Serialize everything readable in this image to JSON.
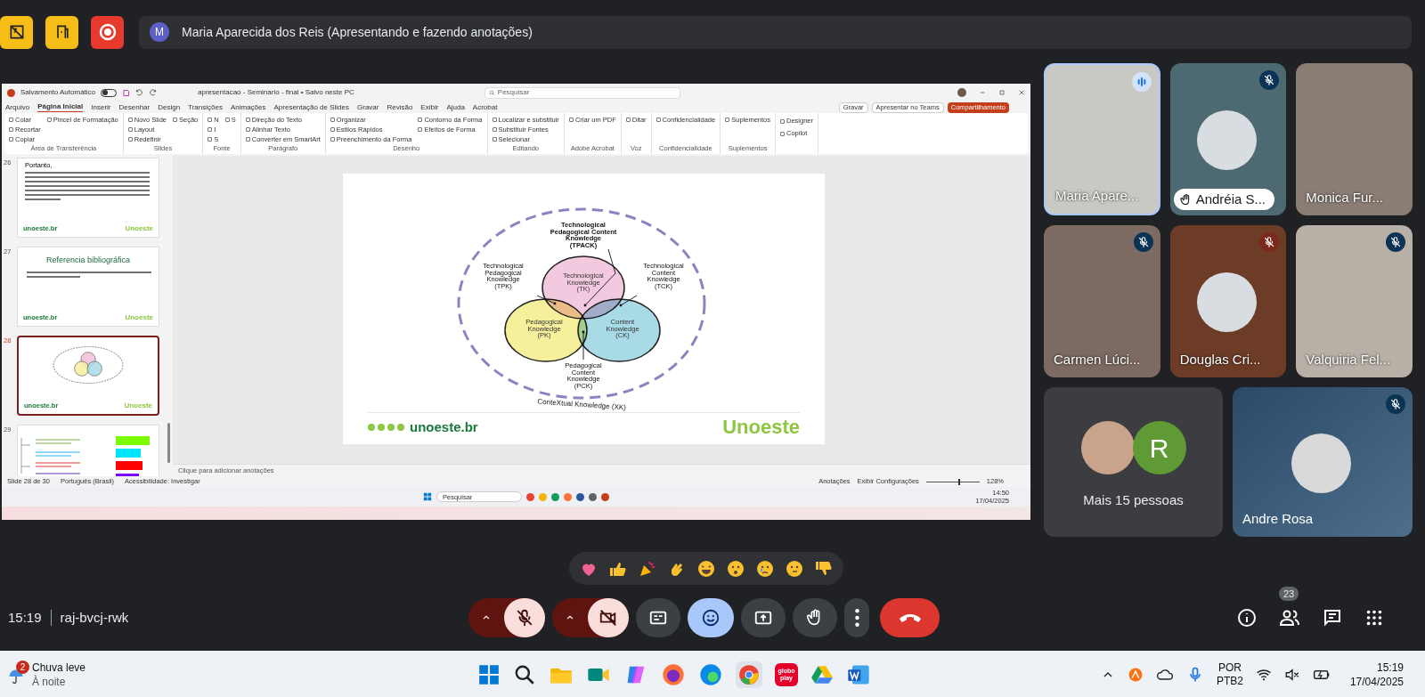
{
  "top_bar": {
    "presenter_initial": "M",
    "presenter_label": "Maria Aparecida dos Reis (Apresentando e fazendo anotações)"
  },
  "shared_screen": {
    "autosave_label": "Salvamento Automático",
    "autosave_on": false,
    "document_title": "apresentacao - Seminario - final • Salvo neste PC",
    "search_placeholder": "Pesquisar",
    "ribbon_tabs": [
      {
        "label": "Arquivo",
        "selected": false
      },
      {
        "label": "Página Inicial",
        "selected": true
      },
      {
        "label": "Inserir",
        "selected": false
      },
      {
        "label": "Desenhar",
        "selected": false
      },
      {
        "label": "Design",
        "selected": false
      },
      {
        "label": "Transições",
        "selected": false
      },
      {
        "label": "Animações",
        "selected": false
      },
      {
        "label": "Apresentação de Slides",
        "selected": false
      },
      {
        "label": "Gravar",
        "selected": false
      },
      {
        "label": "Revisão",
        "selected": false
      },
      {
        "label": "Exibir",
        "selected": false
      },
      {
        "label": "Ajuda",
        "selected": false
      },
      {
        "label": "Acrobat",
        "selected": false
      }
    ],
    "ribbon_buttons": [
      {
        "label": "Gravar",
        "kind": "plain"
      },
      {
        "label": "Apresentar no Teams",
        "kind": "plain"
      },
      {
        "label": "Compartilhamento",
        "kind": "accent"
      }
    ],
    "ribbon_groups": [
      {
        "label": "Área de Transferência",
        "items": [
          "Colar",
          "Recortar",
          "Copiar",
          "Pincel de Formatação"
        ]
      },
      {
        "label": "Slides",
        "items": [
          "Novo Slide",
          "Layout",
          "Redefinir",
          "Seção"
        ]
      },
      {
        "label": "Fonte",
        "items": [
          "N",
          "I",
          "S",
          "S"
        ]
      },
      {
        "label": "Parágrafo",
        "items": [
          "Direção do Texto",
          "Alinhar Texto",
          "Converter em SmartArt"
        ]
      },
      {
        "label": "Desenho",
        "items": [
          "Organizar",
          "Estilos Rápidos",
          "Preenchimento da Forma",
          "Contorno da Forma",
          "Efeitos de Forma"
        ]
      },
      {
        "label": "Editando",
        "items": [
          "Localizar e substituir",
          "Substituir Fontes",
          "Selecionar"
        ]
      },
      {
        "label": "Adobe Acrobat",
        "items": [
          "Criar um PDF"
        ]
      },
      {
        "label": "Voz",
        "items": [
          "Ditar"
        ]
      },
      {
        "label": "Confidencialidade",
        "items": [
          "Confidencialidade"
        ]
      },
      {
        "label": "Suplementos",
        "items": [
          "Suplementos"
        ]
      },
      {
        "items": [
          "Designer",
          "Copilot"
        ]
      }
    ],
    "slides": [
      {
        "number": "26",
        "kind": "text",
        "selected": false,
        "heading": "Portanto,",
        "footer_url": "unoeste.br",
        "brand": "Unoeste"
      },
      {
        "number": "27",
        "kind": "title",
        "selected": false,
        "title": "Referencia bibliográfica",
        "footer_url": "unoeste.br",
        "brand": "Unoeste"
      },
      {
        "number": "28",
        "kind": "diagram",
        "selected": true,
        "footer_url": "unoeste.br",
        "brand": "Unoeste"
      },
      {
        "number": "29",
        "kind": "chart",
        "selected": false
      }
    ],
    "diagram": {
      "circles": [
        {
          "label": [
            "Technological",
            "Knowledge",
            "(TK)"
          ],
          "color": "#f2c9de"
        },
        {
          "label": [
            "Pedagogical",
            "Knowledge",
            "(PK)"
          ],
          "color": "#f6ef9c"
        },
        {
          "label": [
            "Content",
            "Knowledge",
            "(CK)"
          ],
          "color": "#a9dbe6"
        }
      ],
      "callouts": [
        {
          "label": [
            "Technological",
            "Pedagogical Content",
            "Knowledge",
            "(TPACK)"
          ]
        },
        {
          "label": [
            "Technological",
            "Pedagogical",
            "Knowledge",
            "(TPK)"
          ]
        },
        {
          "label": [
            "Technological",
            "Content",
            "Knowledge",
            "(TCK)"
          ]
        },
        {
          "label": [
            "Pedagogical",
            "Content",
            "Knowledge",
            "(PCK)"
          ]
        }
      ],
      "context_label": "ConteXtual Knowledge (XK)"
    },
    "slide_footer_url": "unoeste.br",
    "slide_brand": "Unoeste",
    "notes_placeholder": "Clique para adicionar anotações",
    "status_bar": {
      "slide_counter": "Slide 28 de 30",
      "language": "Português (Brasil)",
      "accessibility": "Acessibilidade: Investigar",
      "notes": "Anotações",
      "display_settings": "Exibir Configurações",
      "zoom_slider": {
        "level": 0.62
      },
      "zoom": "128%"
    },
    "taskbar": {
      "search_placeholder": "Pesquisar",
      "time": "14:50",
      "date": "17/04/2025"
    }
  },
  "participants": [
    {
      "name": "Maria Apare...",
      "kind": "video",
      "muted": false,
      "speaking": true,
      "hand_raised": false,
      "color": "#c9c9c4"
    },
    {
      "name": "Andréia S...",
      "kind": "avatar",
      "muted": true,
      "speaking": false,
      "hand_raised": true,
      "color": "#4d6a73"
    },
    {
      "name": "Monica Fur...",
      "kind": "video",
      "muted": false,
      "speaking": false,
      "hand_raised": false,
      "color": "#8a7d74"
    },
    {
      "name": "Carmen Lúci...",
      "kind": "video",
      "muted": true,
      "speaking": false,
      "hand_raised": false,
      "color": "#7d6a62"
    },
    {
      "name": "Douglas Cri...",
      "kind": "avatar",
      "muted": true,
      "speaking": false,
      "hand_raised": false,
      "color": "#6d3c27"
    },
    {
      "name": "Valquiria Fel...",
      "kind": "video",
      "muted": true,
      "speaking": false,
      "hand_raised": false,
      "color": "#b8afa6"
    }
  ],
  "more_tile": {
    "label": "Mais 15 pessoas",
    "avatar_letter": "R"
  },
  "featured_tile": {
    "name": "Andre Rosa",
    "muted": true
  },
  "call": {
    "time": "15:19",
    "meeting_code": "raj-bvcj-rwk",
    "mic_on": false,
    "camera_on": false,
    "people_count": "23"
  },
  "windows_taskbar": {
    "weather_badge": "2",
    "weather": "Chuva leve",
    "weather_sub": "À noite",
    "app_label": "globo play",
    "lang": "POR",
    "layout": "PTB2",
    "time": "15:19",
    "date": "17/04/2025"
  }
}
